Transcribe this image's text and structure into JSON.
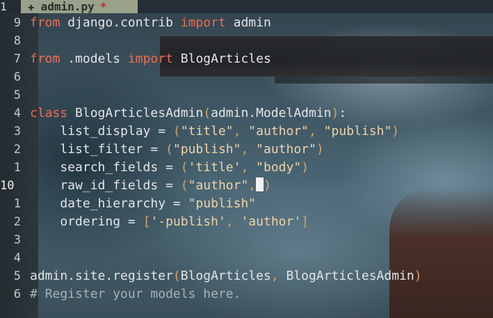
{
  "tab": {
    "count": "1",
    "icon": "✚",
    "filename": "admin.py",
    "modified_marker": "*"
  },
  "lines": [
    {
      "num": "9",
      "current": false,
      "tokens": [
        [
          "kw",
          "from"
        ],
        [
          "nm",
          " django.contrib "
        ],
        [
          "kw",
          "import"
        ],
        [
          "nm",
          " admin"
        ]
      ]
    },
    {
      "num": "8",
      "current": false,
      "tokens": []
    },
    {
      "num": "7",
      "current": false,
      "tokens": [
        [
          "kw",
          "from"
        ],
        [
          "nm",
          " .models "
        ],
        [
          "kw",
          "import"
        ],
        [
          "nm",
          " BlogArticles"
        ]
      ]
    },
    {
      "num": "6",
      "current": false,
      "tokens": []
    },
    {
      "num": "5",
      "current": false,
      "tokens": []
    },
    {
      "num": "4",
      "current": false,
      "tokens": [
        [
          "kw",
          "class"
        ],
        [
          "nm",
          " BlogArticlesAdmin"
        ],
        [
          "pn",
          "("
        ],
        [
          "nm",
          "admin.ModelAdmin"
        ],
        [
          "pn",
          ")"
        ],
        [
          "nm",
          ":"
        ]
      ]
    },
    {
      "num": "3",
      "current": false,
      "tokens": [
        [
          "nm",
          "    list_display = "
        ],
        [
          "pn",
          "("
        ],
        [
          "st",
          "\"title\""
        ],
        [
          "pn",
          ", "
        ],
        [
          "st",
          "\"author\""
        ],
        [
          "pn",
          ", "
        ],
        [
          "st",
          "\"publish\""
        ],
        [
          "pn",
          ")"
        ]
      ]
    },
    {
      "num": "2",
      "current": false,
      "tokens": [
        [
          "nm",
          "    list_filter = "
        ],
        [
          "pn",
          "("
        ],
        [
          "st",
          "\"publish\""
        ],
        [
          "pn",
          ", "
        ],
        [
          "st",
          "\"author\""
        ],
        [
          "pn",
          ")"
        ]
      ]
    },
    {
      "num": "1",
      "current": false,
      "tokens": [
        [
          "nm",
          "    search_fields = "
        ],
        [
          "pn",
          "("
        ],
        [
          "st",
          "'title'"
        ],
        [
          "pn",
          ", "
        ],
        [
          "st",
          "\"body\""
        ],
        [
          "pn",
          ")"
        ]
      ]
    },
    {
      "num": "10",
      "current": true,
      "tokens": [
        [
          "nm",
          "    raw_id_fields = "
        ],
        [
          "pn",
          "("
        ],
        [
          "st",
          "\"author\""
        ],
        [
          "pn",
          ","
        ],
        [
          "cursor",
          ""
        ],
        [
          "pn",
          ")"
        ]
      ]
    },
    {
      "num": "1",
      "current": false,
      "tokens": [
        [
          "nm",
          "    date_hierarchy = "
        ],
        [
          "st",
          "\"publish\""
        ]
      ]
    },
    {
      "num": "2",
      "current": false,
      "tokens": [
        [
          "nm",
          "    ordering = "
        ],
        [
          "pn",
          "["
        ],
        [
          "st",
          "'-publish'"
        ],
        [
          "pn",
          ", "
        ],
        [
          "st",
          "'author'"
        ],
        [
          "pn",
          "]"
        ]
      ]
    },
    {
      "num": "3",
      "current": false,
      "tokens": []
    },
    {
      "num": "4",
      "current": false,
      "tokens": []
    },
    {
      "num": "5",
      "current": false,
      "tokens": [
        [
          "nm",
          "admin.site.register"
        ],
        [
          "pn",
          "("
        ],
        [
          "nm",
          "BlogArticles"
        ],
        [
          "pn",
          ", "
        ],
        [
          "nm",
          "BlogArticlesAdmin"
        ],
        [
          "pn",
          ")"
        ]
      ]
    },
    {
      "num": "6",
      "current": false,
      "tokens": [
        [
          "cm",
          "# Register your models here."
        ]
      ]
    }
  ],
  "colors": {
    "keyword": "#ef6b52",
    "string": "#efd3a8",
    "punctuation": "#d8a35f",
    "comment": "#a8b2b6",
    "tab_active": "#9aa18a"
  }
}
